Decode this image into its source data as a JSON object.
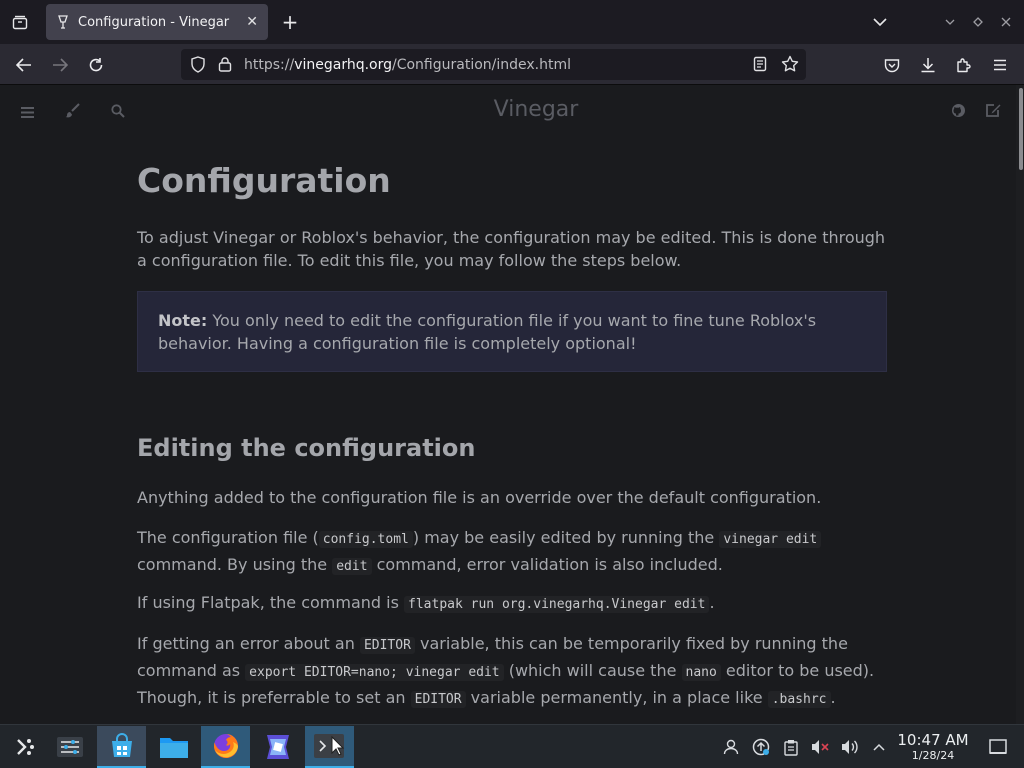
{
  "browser": {
    "tab_title": "Configuration - Vinegar",
    "url_host": "vinegarhq.org",
    "url_prefix": "https://",
    "url_path": "/Configuration/index.html"
  },
  "page": {
    "site_title": "Vinegar",
    "heading": "Configuration",
    "intro": "To adjust Vinegar or Roblox's behavior, the configuration may be edited. This is done through a configuration file. To edit this file, you may follow the steps below.",
    "note_label": "Note:",
    "note_text": " You only need to edit the configuration file if you want to fine tune Roblox's behavior. Having a configuration file is completely optional!",
    "section_heading": "Editing the configuration",
    "para1": "Anything added to the configuration file is an override over the default configuration.",
    "para2": {
      "a": "The configuration file (",
      "code1": "config.toml",
      "b": ") may be easily edited by running the ",
      "code2": "vinegar edit",
      "c": " command. By using the ",
      "code3": "edit",
      "d": " command, error validation is also included."
    },
    "para3": {
      "a": "If using Flatpak, the command is ",
      "code1": "flatpak run org.vinegarhq.Vinegar edit",
      "b": "."
    },
    "para4": {
      "a": "If getting an error about an ",
      "code1": "EDITOR",
      "b": " variable, this can be temporarily fixed by running the command as ",
      "code2": "export EDITOR=nano; vinegar edit",
      "c": " (which will cause the ",
      "code3": "nano",
      "d": " editor to be used). Though, it is preferrable to set an ",
      "code4": "EDITOR",
      "e": " variable permanently, in a place like ",
      "code5": ".bashrc",
      "f": "."
    }
  },
  "taskbar": {
    "clock_time": "10:47 AM",
    "clock_date": "1/28/24"
  },
  "colors": {
    "accent": "#3daee9",
    "page_bg": "#1a1b1e",
    "note_bg": "#252639"
  }
}
